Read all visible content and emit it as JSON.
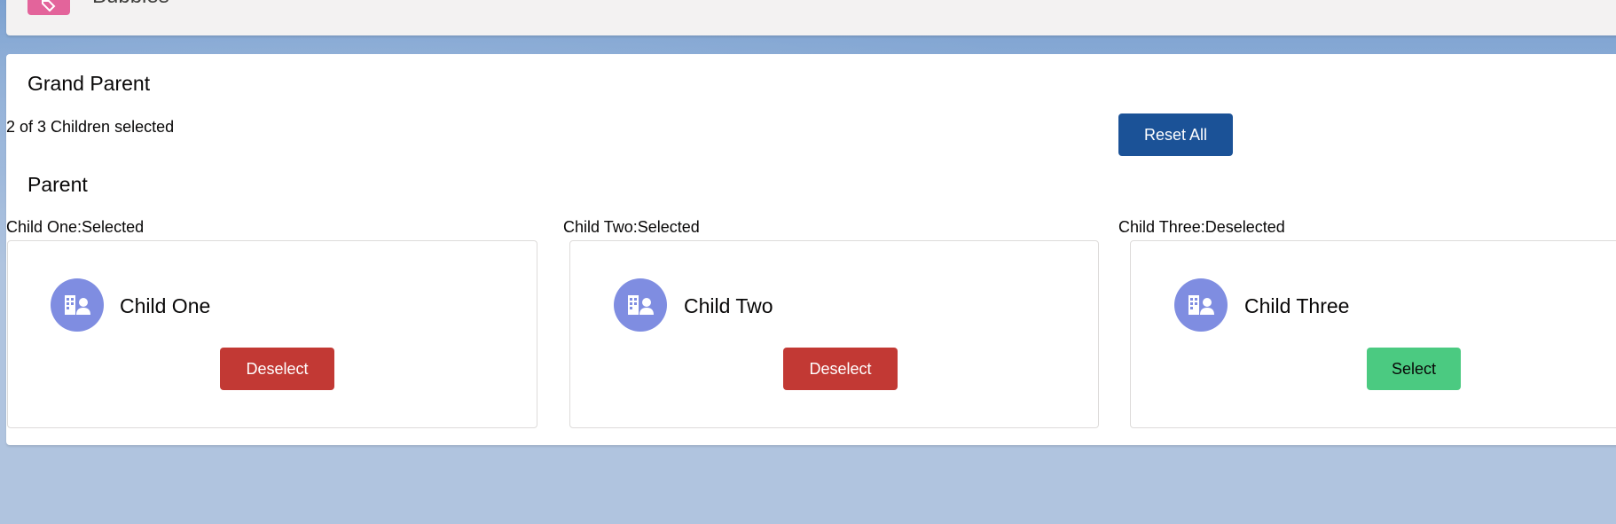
{
  "header": {
    "title": "Bubbles",
    "icon": "tag-icon",
    "icon_color": "#e3649b"
  },
  "grand_parent": {
    "title": "Grand Parent",
    "status": "2 of 3 Children selected",
    "reset_label": "Reset All",
    "reset_color": "#1b5297"
  },
  "parent": {
    "title": "Parent"
  },
  "children": [
    {
      "status": "Child One:Selected",
      "name": "Child One",
      "icon": "account-icon",
      "button_label": "Deselect",
      "selected": true
    },
    {
      "status": "Child Two:Selected",
      "name": "Child Two",
      "icon": "account-icon",
      "button_label": "Deselect",
      "selected": true
    },
    {
      "status": "Child Three:Deselected",
      "name": "Child Three",
      "icon": "account-icon",
      "button_label": "Select",
      "selected": false
    }
  ],
  "colors": {
    "deselect": "#c23934",
    "select": "#4bca81",
    "avatar": "#7f8de1",
    "background": "#b0c4df"
  }
}
